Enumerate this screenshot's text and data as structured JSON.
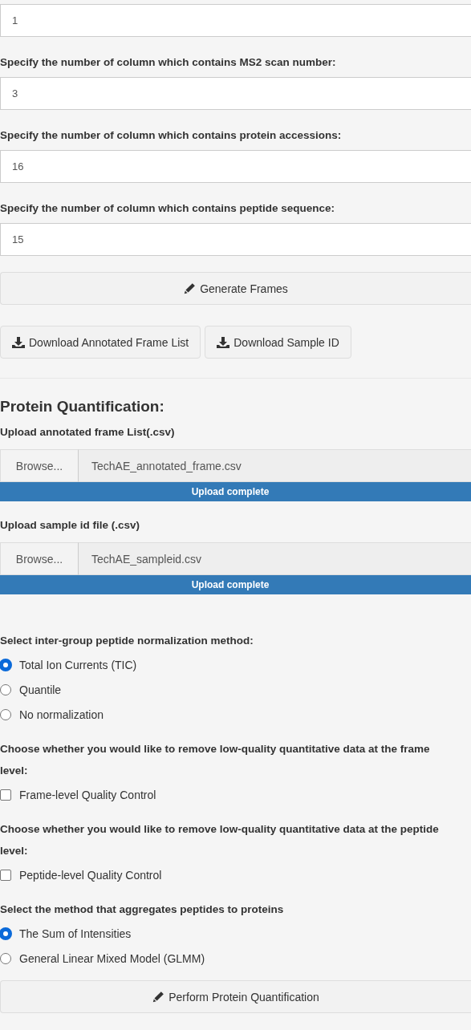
{
  "sections": [
    {
      "kind": "number_input",
      "value": "1"
    },
    {
      "kind": "number_input",
      "label": "Specify the number of column which contains MS2 scan number:",
      "value": "3"
    },
    {
      "kind": "number_input",
      "label": "Specify the number of column which contains protein accessions:",
      "value": "16"
    },
    {
      "kind": "number_input",
      "label": "Specify the number of column which contains peptide sequence:",
      "value": "15"
    },
    {
      "kind": "wide_button",
      "label": "Generate Frames"
    },
    {
      "kind": "button_row",
      "buttons": [
        {
          "label": "Download Annotated Frame List"
        },
        {
          "label": "Download Sample ID"
        }
      ]
    },
    {
      "kind": "divider"
    },
    {
      "kind": "heading",
      "text": "Protein Quantification:"
    },
    {
      "kind": "file_upload",
      "label": "Upload annotated frame List(.csv)",
      "browse": "Browse...",
      "filename": "TechAE_annotated_frame.csv",
      "progress": {
        "text": "Upload complete",
        "level": 1
      }
    },
    {
      "kind": "file_upload",
      "label": "Upload sample id file (.csv)",
      "browse": "Browse...",
      "filename": "TechAE_sampleid.csv",
      "progress": {
        "text": "Upload complete",
        "level": 1
      }
    },
    {
      "kind": "radio_group",
      "label": "Select inter-group peptide normalization method:",
      "options": [
        {
          "label": "Total Ion Currents (TIC)",
          "selected": true
        },
        {
          "label": "Quantile",
          "selected": false
        },
        {
          "label": "No normalization",
          "selected": false
        }
      ]
    },
    {
      "kind": "checkbox",
      "label": "Choose whether you would like to remove low-quality quantitative data at the frame level:",
      "option": "Frame-level Quality Control",
      "checked": false
    },
    {
      "kind": "checkbox",
      "label": "Choose whether you would like to remove low-quality quantitative data at the peptide level:",
      "option": "Peptide-level Quality Control",
      "checked": false
    },
    {
      "kind": "radio_group",
      "label": "Select the method that aggregates peptides to proteins",
      "options": [
        {
          "label": "The Sum of Intensities",
          "selected": true
        },
        {
          "label": "General Linear Mixed Model (GLMM)",
          "selected": false
        }
      ]
    },
    {
      "kind": "wide_button",
      "label": "Perform Protein Quantification"
    }
  ]
}
